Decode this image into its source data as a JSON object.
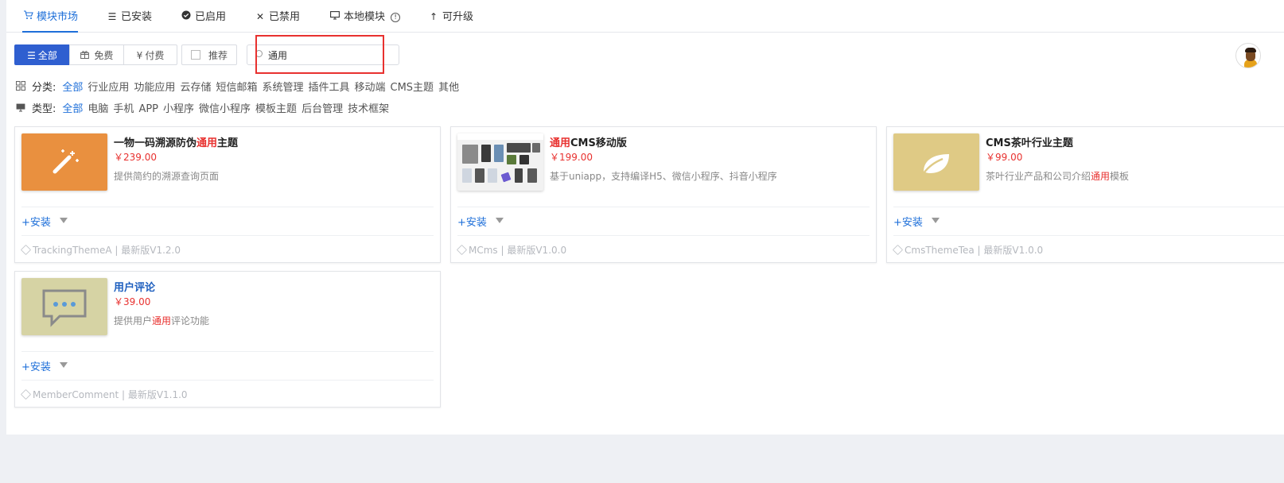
{
  "tabs": [
    {
      "label": "模块市场",
      "icon": "cart-icon",
      "active": true
    },
    {
      "label": "已安装",
      "icon": "list-icon"
    },
    {
      "label": "已启用",
      "icon": "check-circle-icon"
    },
    {
      "label": "已禁用",
      "icon": "close-icon"
    },
    {
      "label": "本地模块",
      "icon": "monitor-icon",
      "info_icon": "info-icon"
    },
    {
      "label": "可升级",
      "icon": "arrow-up-icon"
    }
  ],
  "price_filter": {
    "all": "全部",
    "free": "免费",
    "paid": "付费",
    "recommend": "推荐"
  },
  "search": {
    "value": "通用"
  },
  "category": {
    "label": "分类:",
    "options": [
      "全部",
      "行业应用",
      "功能应用",
      "云存储",
      "短信邮箱",
      "系统管理",
      "插件工具",
      "移动端",
      "CMS主题",
      "其他"
    ]
  },
  "type": {
    "label": "类型:",
    "options": [
      "全部",
      "电脑",
      "手机",
      "APP",
      "小程序",
      "微信小程序",
      "模板主题",
      "后台管理",
      "技术框架"
    ]
  },
  "cards": [
    {
      "title_pre": "一物一码溯源防伪",
      "title_hl": "通用",
      "title_post": "主题",
      "price": "￥239.00",
      "desc_pre": "提供简约的溯源查询页面",
      "desc_hl": "",
      "desc_post": "",
      "install": "+安装",
      "meta": "TrackingThemeA | 最新版V1.2.0",
      "thumb_color": "#e9903f",
      "thumb_icon": "magic-wand-icon"
    },
    {
      "title_pre": "",
      "title_hl": "通用",
      "title_post": "CMS移动版",
      "price": "￥199.00",
      "desc_pre": "基于uniapp，支持编译H5、微信小程序、抖音小程序",
      "desc_hl": "",
      "desc_post": "",
      "install": "+安装",
      "meta": "MCms | 最新版V1.0.0",
      "thumb_icon": "app-screenshots"
    },
    {
      "title_pre": "CMS茶叶行业主题",
      "title_hl": "",
      "title_post": "",
      "price": "￥99.00",
      "desc_pre": "茶叶行业产品和公司介绍",
      "desc_hl": "通用",
      "desc_post": "模板",
      "install": "+安装",
      "meta": "CmsThemeTea | 最新版V1.0.0",
      "thumb_color": "#dfca85",
      "thumb_icon": "leaf-icon"
    },
    {
      "title_pre": "用户评论",
      "title_hl": "",
      "title_post": "",
      "price": "￥39.00",
      "desc_pre": "提供用户",
      "desc_hl": "通用",
      "desc_post": "评论功能",
      "install": "+安装",
      "meta": "MemberComment | 最新版V1.1.0",
      "thumb_color": "#d6d3a4",
      "thumb_icon": "chat-bubble-icon"
    }
  ],
  "colors": {
    "accent": "#1e6fd9",
    "primary_button": "#2f5fd0",
    "highlight": "#e8312f",
    "price": "#e8312f"
  }
}
